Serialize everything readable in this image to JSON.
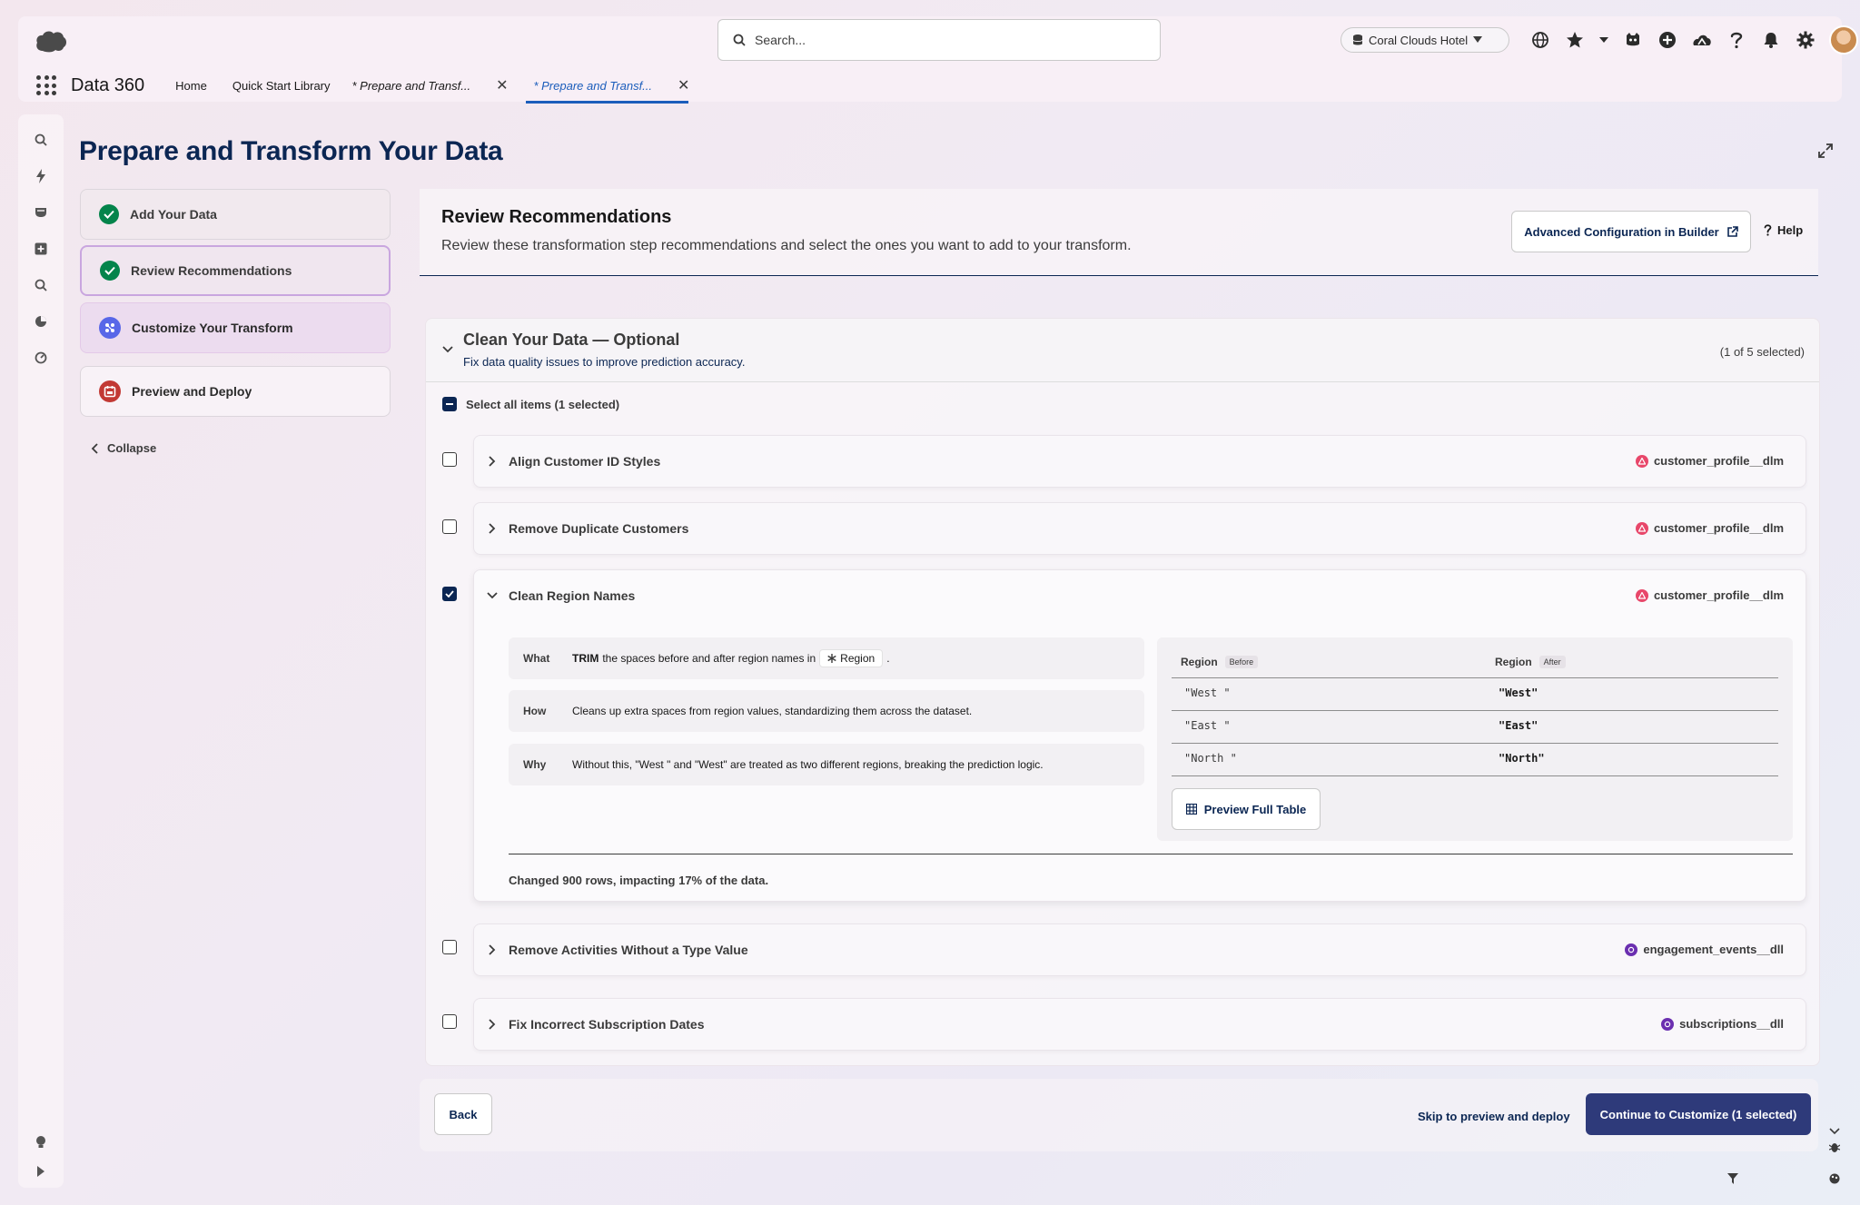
{
  "header": {
    "search_placeholder": "Search...",
    "org_name": "Coral Clouds Hotel",
    "app_name": "Data 360",
    "tabs": [
      {
        "label": "Home"
      },
      {
        "label": "Quick Start Library"
      },
      {
        "label": "* Prepare and Transf..."
      },
      {
        "label": "* Prepare and Transf..."
      }
    ]
  },
  "page": {
    "title": "Prepare and Transform Your Data"
  },
  "steps": [
    {
      "label": "Add Your Data",
      "state": "complete"
    },
    {
      "label": "Review Recommendations",
      "state": "complete"
    },
    {
      "label": "Customize Your Transform",
      "state": "in-progress"
    },
    {
      "label": "Preview and Deploy",
      "state": "pending"
    }
  ],
  "collapse_label": "Collapse",
  "review": {
    "title": "Review Recommendations",
    "description": "Review these transformation step recommendations and select the ones you want to add to your transform.",
    "advanced_button": "Advanced Configuration in Builder",
    "help_label": "Help"
  },
  "section": {
    "title": "Clean Your Data — Optional",
    "subtitle": "Fix data quality issues to improve prediction accuracy.",
    "count": "(1 of 5 selected)",
    "select_all": "Select all items (1 selected)",
    "recommendations": [
      {
        "title": "Align Customer ID Styles",
        "dataset": "customer_profile__dlm",
        "checked": false
      },
      {
        "title": "Remove Duplicate Customers",
        "dataset": "customer_profile__dlm",
        "checked": false
      },
      {
        "title": "Clean Region Names",
        "dataset": "customer_profile__dlm",
        "checked": true
      },
      {
        "title": "Remove Activities Without a Type Value",
        "dataset": "engagement_events__dll",
        "checked": false
      },
      {
        "title": "Fix Incorrect Subscription Dates",
        "dataset": "subscriptions__dll",
        "checked": false
      }
    ],
    "detail": {
      "what_label": "What",
      "what_keyword": "TRIM",
      "what_text": "the spaces before and after region names in",
      "what_field": "Region",
      "what_end": ".",
      "how_label": "How",
      "how_text": "Cleans up extra spaces from region values, standardizing them across the dataset.",
      "why_label": "Why",
      "why_text": "Without this, \"West \" and \"West\" are treated as two different regions, breaking the prediction logic.",
      "preview": {
        "before_header": "Region",
        "before_tag": "Before",
        "after_header": "Region",
        "after_tag": "After",
        "rows": [
          {
            "before": "\"West \"",
            "after": "\"West\""
          },
          {
            "before": "\"East \"",
            "after": "\"East\""
          },
          {
            "before": "\"North \"",
            "after": "\"North\""
          }
        ],
        "button": "Preview Full Table"
      },
      "changed": "Changed 900 rows, impacting 17% of the data."
    }
  },
  "footer": {
    "back": "Back",
    "skip": "Skip to preview and deploy",
    "continue": "Continue to Customize (1 selected)"
  },
  "colors": {
    "title_navy": "#0b2653",
    "brand_blue": "#1b5dbb",
    "primary_button": "#2e3a7a",
    "complete_green": "#04844b",
    "in_progress_purple": "#5867e8",
    "pending_magenta": "#c23934",
    "dataset_pink": "#e8476a",
    "dataset_purple": "#6b2fb0"
  }
}
